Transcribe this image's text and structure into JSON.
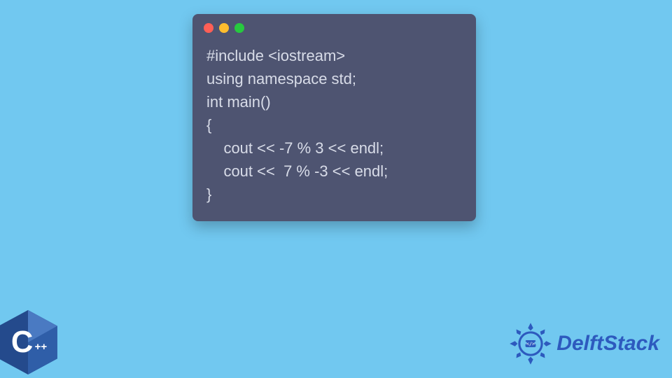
{
  "code": {
    "line1": "#include <iostream>",
    "line2": "using namespace std;",
    "line3": "int main()",
    "line4": "{",
    "line5": "    cout << -7 % 3 << endl;",
    "line6": "    cout <<  7 % -3 << endl;",
    "line7": "}"
  },
  "cpp_logo": {
    "letter": "C",
    "plus": "++"
  },
  "brand": {
    "name": "DelftStack"
  }
}
